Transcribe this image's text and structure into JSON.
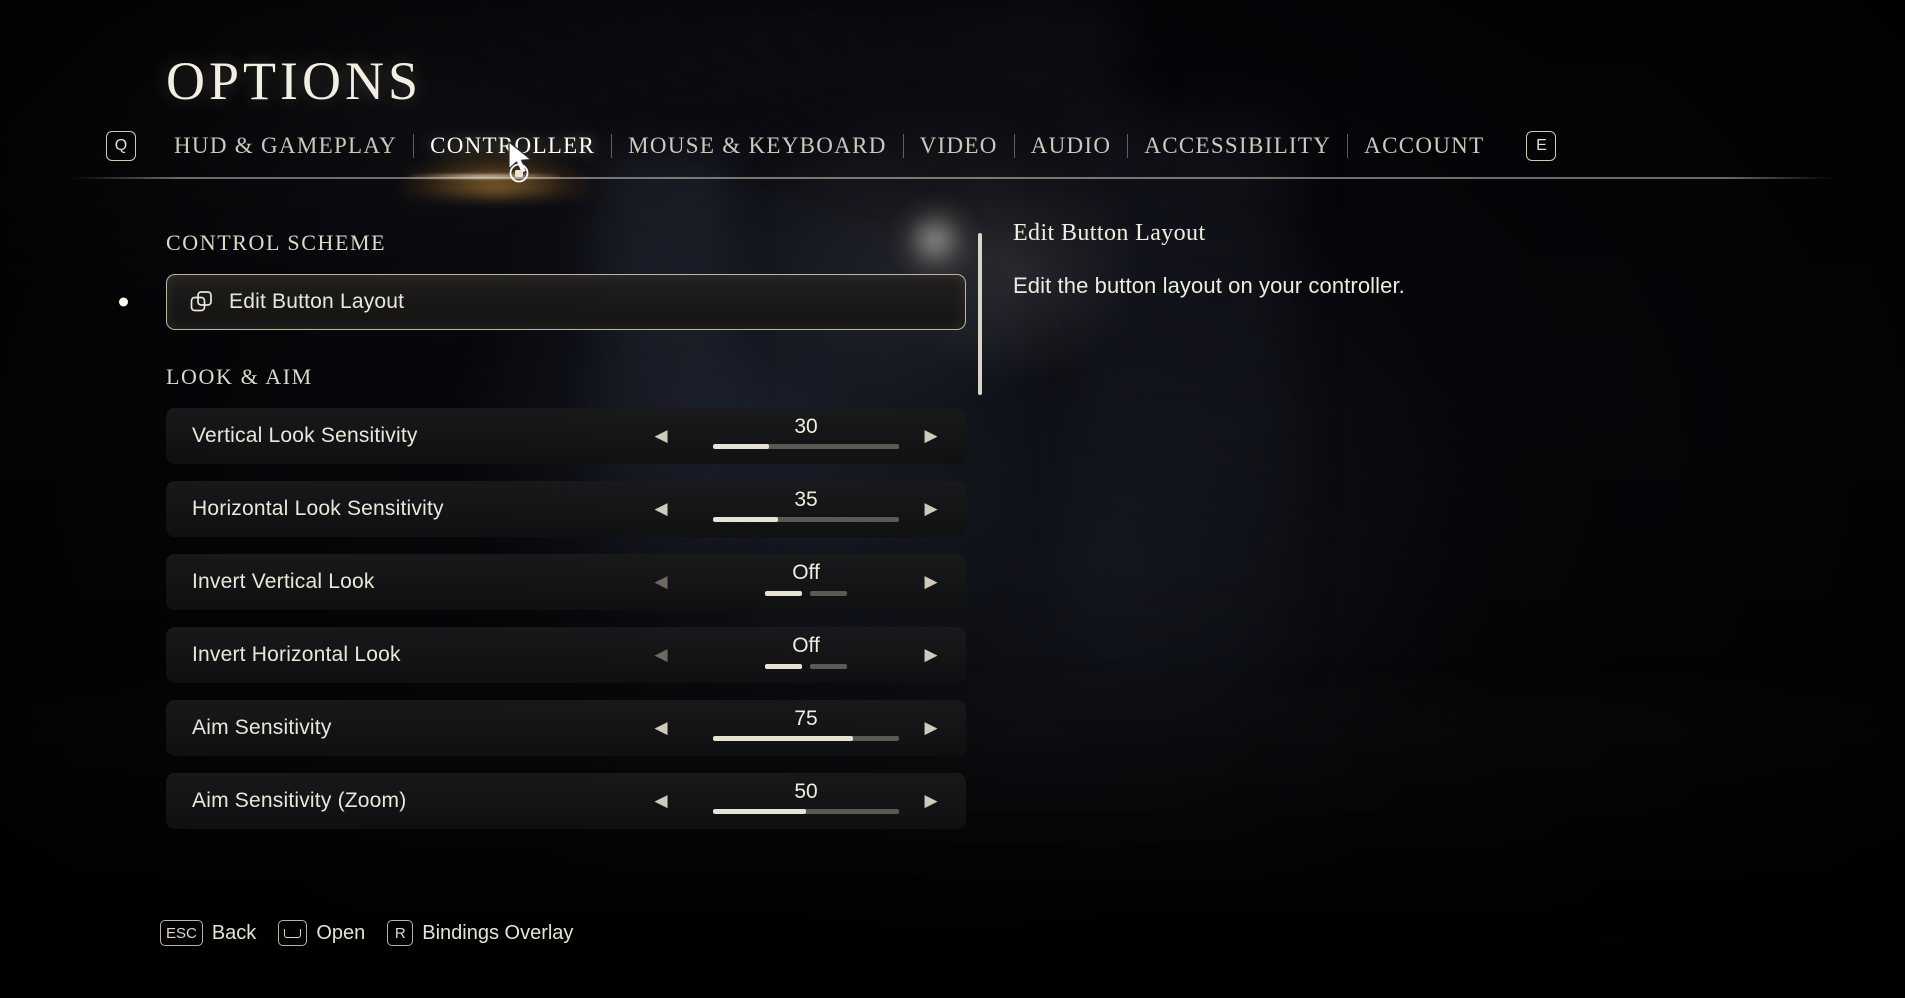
{
  "header": {
    "title": "OPTIONS",
    "prev_key": "Q",
    "next_key": "E",
    "tabs": [
      {
        "label": "HUD & GAMEPLAY",
        "active": false
      },
      {
        "label": "CONTROLLER",
        "active": true
      },
      {
        "label": "MOUSE & KEYBOARD",
        "active": false
      },
      {
        "label": "VIDEO",
        "active": false
      },
      {
        "label": "AUDIO",
        "active": false
      },
      {
        "label": "ACCESSIBILITY",
        "active": false
      },
      {
        "label": "ACCOUNT",
        "active": false
      }
    ]
  },
  "sections": [
    {
      "heading": "CONTROL SCHEME",
      "rows": [
        {
          "label": "Edit Button Layout",
          "type": "action",
          "icon": "layers-icon",
          "selected": true
        }
      ]
    },
    {
      "heading": "LOOK & AIM",
      "rows": [
        {
          "label": "Vertical Look Sensitivity",
          "type": "slider",
          "value": "30",
          "percent": 30,
          "left_arrow": "◀",
          "right_arrow": "▶",
          "left_enabled": true
        },
        {
          "label": "Horizontal Look Sensitivity",
          "type": "slider",
          "value": "35",
          "percent": 35,
          "left_arrow": "◀",
          "right_arrow": "▶",
          "left_enabled": true
        },
        {
          "label": "Invert Vertical Look",
          "type": "toggle",
          "value": "Off",
          "segments": [
            true,
            false
          ],
          "left_arrow": "◀",
          "right_arrow": "▶",
          "left_enabled": false
        },
        {
          "label": "Invert Horizontal Look",
          "type": "toggle",
          "value": "Off",
          "segments": [
            true,
            false
          ],
          "left_arrow": "◀",
          "right_arrow": "▶",
          "left_enabled": false
        },
        {
          "label": "Aim Sensitivity",
          "type": "slider",
          "value": "75",
          "percent": 75,
          "left_arrow": "◀",
          "right_arrow": "▶",
          "left_enabled": true
        },
        {
          "label": "Aim Sensitivity (Zoom)",
          "type": "slider",
          "value": "50",
          "percent": 50,
          "left_arrow": "◀",
          "right_arrow": "▶",
          "left_enabled": true
        }
      ]
    }
  ],
  "description": {
    "title": "Edit Button Layout",
    "body": "Edit the button layout on your controller."
  },
  "footer": {
    "hints": [
      {
        "key": "ESC",
        "glyph": false,
        "label": "Back"
      },
      {
        "key": "",
        "glyph": true,
        "label": "Open"
      },
      {
        "key": "R",
        "glyph": false,
        "label": "Bindings Overlay"
      }
    ]
  },
  "colors": {
    "accent_glow": "#ffba46",
    "text_primary": "#f0ece0",
    "track_empty": "#5b5954",
    "track_fill": "#e6e2d4",
    "selected_border": "#b9b4a6"
  }
}
